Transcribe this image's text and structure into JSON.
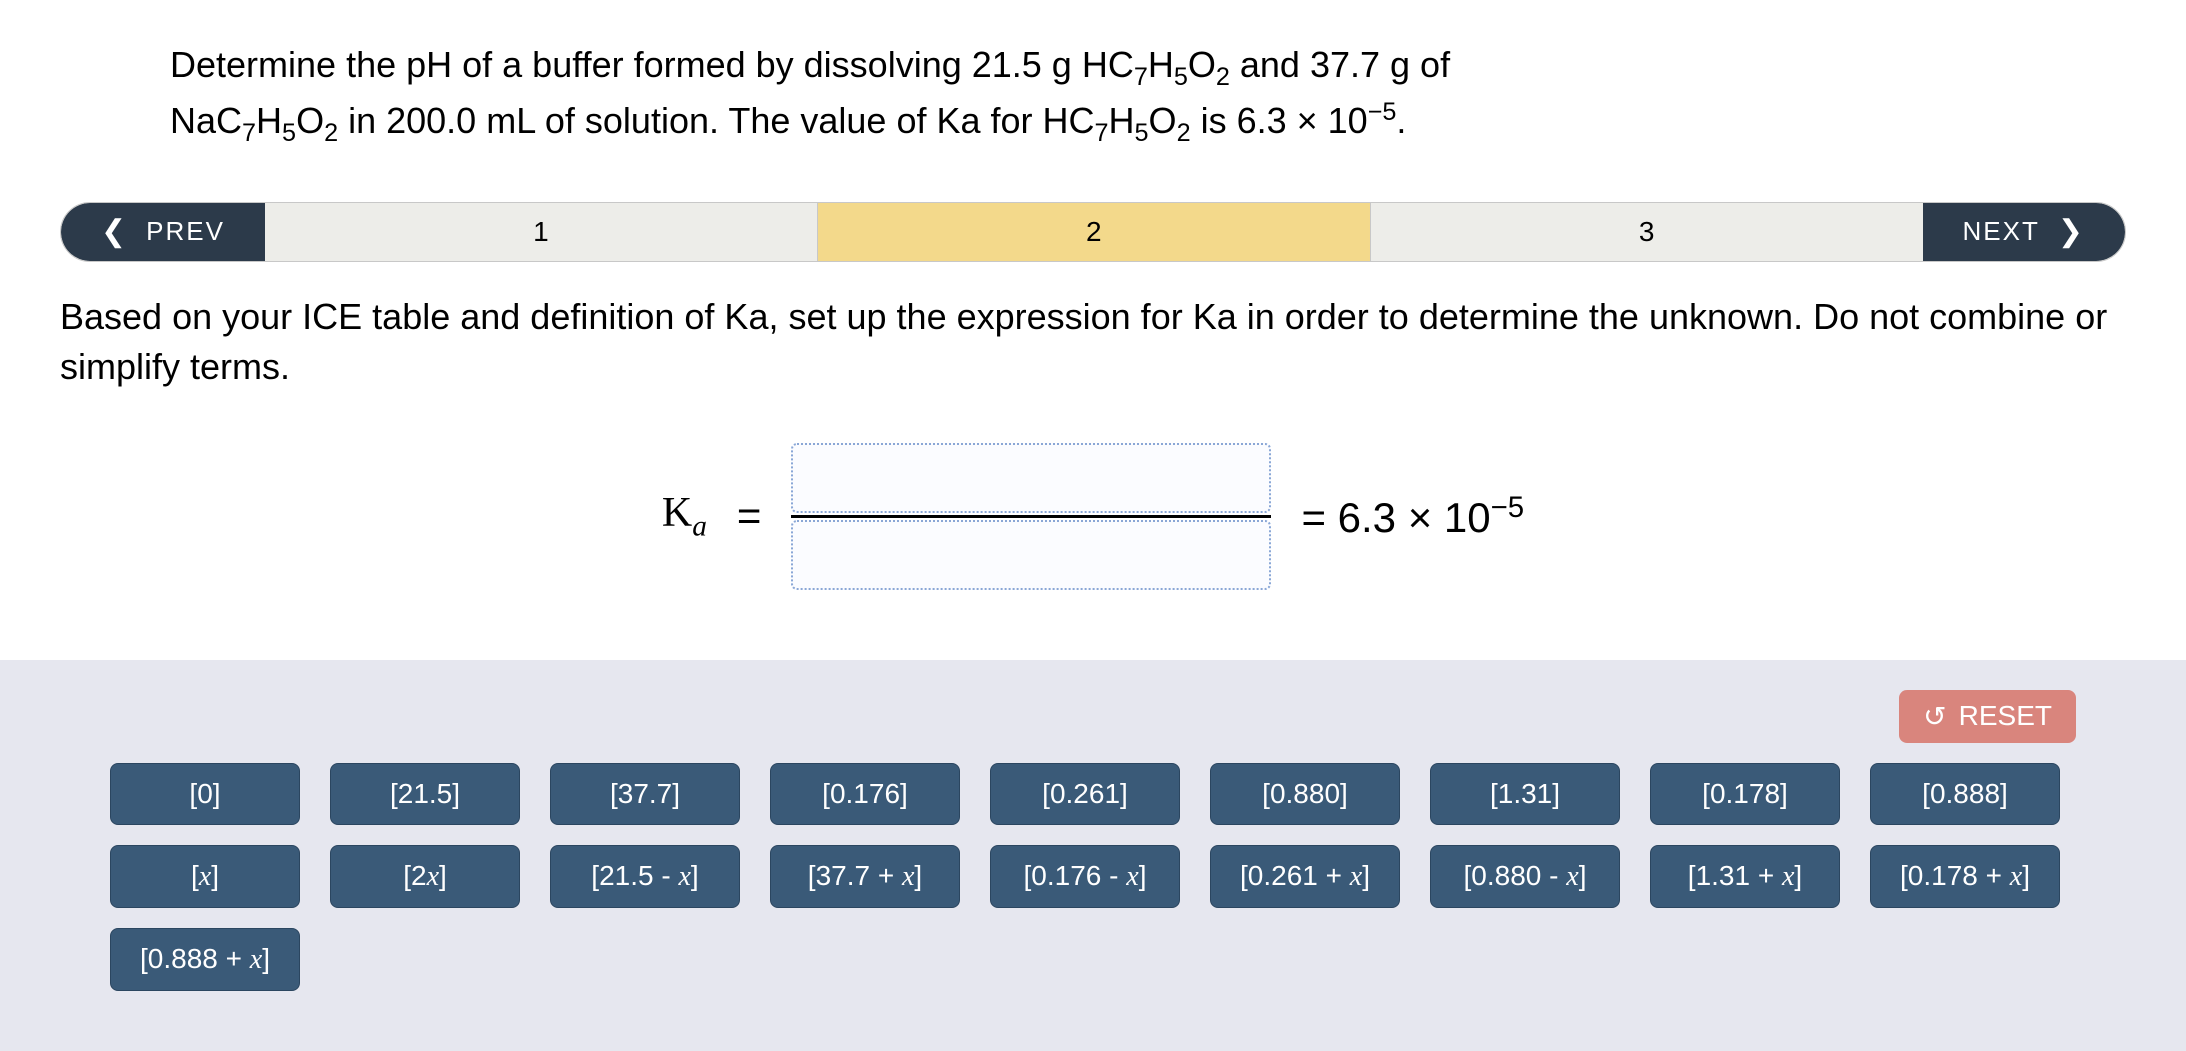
{
  "question": {
    "line1_pre": "Determine the pH of a buffer formed by dissolving 21.5 g HC",
    "line1_mid1": "H",
    "line1_mid2": "O",
    "line1_post1": " and 37.7 g of",
    "line2_pre": "NaC",
    "line2_mid1": "H",
    "line2_mid2": "O",
    "line2_post1": " in 200.0 mL of solution. The value of Ka for HC",
    "line2_mid3": "H",
    "line2_mid4": "O",
    "line2_post2": " is 6.3 × 10",
    "line2_end": "."
  },
  "nav": {
    "prev": "PREV",
    "next": "NEXT",
    "steps": [
      "1",
      "2",
      "3"
    ],
    "active_index": 1
  },
  "instruction": "Based on your ICE table and definition of Ka, set up the expression for Ka in order to determine the unknown. Do not combine or simplify terms.",
  "equation": {
    "lhs_main": "K",
    "lhs_sub": "a",
    "eq": "=",
    "rhs_prefix": "=  6.3 × 10",
    "rhs_exp": "−5"
  },
  "reset": "RESET",
  "tiles": [
    {
      "label": "[0]",
      "has_x": false
    },
    {
      "label": "[21.5]",
      "has_x": false
    },
    {
      "label": "[37.7]",
      "has_x": false
    },
    {
      "label": "[0.176]",
      "has_x": false
    },
    {
      "label": "[0.261]",
      "has_x": false
    },
    {
      "label": "[0.880]",
      "has_x": false
    },
    {
      "label": "[1.31]",
      "has_x": false
    },
    {
      "label": "[0.178]",
      "has_x": false
    },
    {
      "label": "[0.888]",
      "has_x": false
    },
    {
      "label_pre": "[",
      "x": "x",
      "label_post": "]",
      "has_x": true
    },
    {
      "label_pre": "[2",
      "x": "x",
      "label_post": "]",
      "has_x": true
    },
    {
      "label_pre": "[21.5 - ",
      "x": "x",
      "label_post": "]",
      "has_x": true
    },
    {
      "label_pre": "[37.7 + ",
      "x": "x",
      "label_post": "]",
      "has_x": true
    },
    {
      "label_pre": "[0.176 - ",
      "x": "x",
      "label_post": "]",
      "has_x": true
    },
    {
      "label_pre": "[0.261 + ",
      "x": "x",
      "label_post": "]",
      "has_x": true
    },
    {
      "label_pre": "[0.880 - ",
      "x": "x",
      "label_post": "]",
      "has_x": true
    },
    {
      "label_pre": "[1.31 + ",
      "x": "x",
      "label_post": "]",
      "has_x": true
    },
    {
      "label_pre": "[0.178 + ",
      "x": "x",
      "label_post": "]",
      "has_x": true
    },
    {
      "label_pre": "[0.888 + ",
      "x": "x",
      "label_post": "]",
      "has_x": true
    }
  ]
}
